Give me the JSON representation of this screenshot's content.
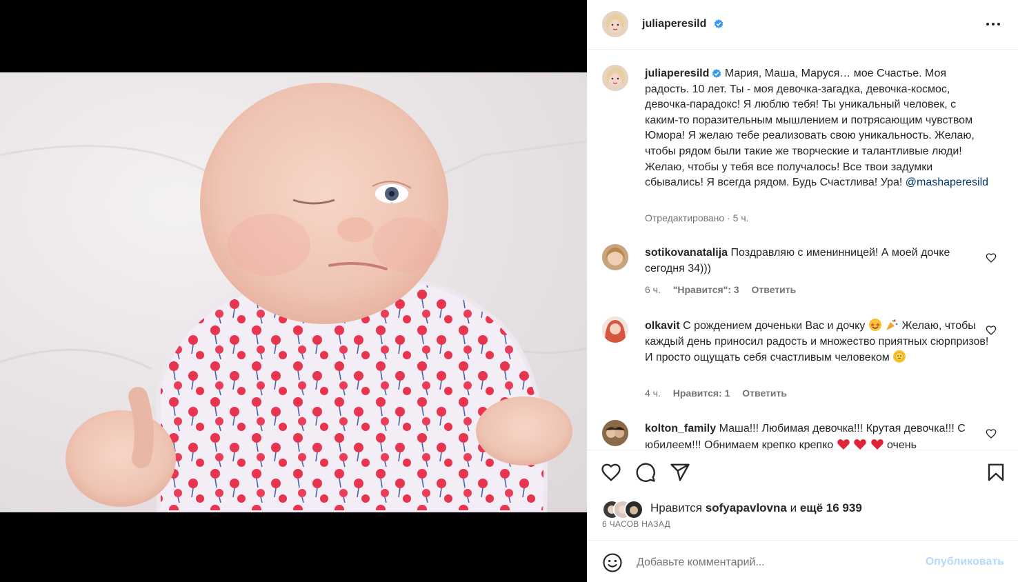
{
  "post": {
    "author": "juliaperesild",
    "caption": "Мария, Маша, Маруся… мое Счастье. Моя радость. 10 лет. Ты - моя девочка-загадка, девочка-космос, девочка-парадокс! Я люблю тебя! Ты уникальный человек, с каким-то поразительным мышлением и потрясающим чувством Юмора! Я желаю тебе реализовать свою уникальность. Желаю, чтобы рядом были такие же творческие и талантливые люди! Желаю, чтобы у тебя все получалось! Все твои задумки сбывались! Я всегда рядом. Будь Счастлива! Ура!",
    "mention": "@mashaperesild",
    "edited": "Отредактировано",
    "edited_sep": " · ",
    "edited_time": "5 ч."
  },
  "comments": [
    {
      "username": "sotikovanatalija",
      "text": "Поздравляю с именинницей! А моей дочке сегодня 34)))",
      "time": "6 ч.",
      "likes": "\"Нравится\": 3",
      "reply": "Ответить"
    },
    {
      "username": "olkavit",
      "text_before": "С рождением доченьки Вас и дочку",
      "text_after": "Желаю, чтобы каждый день приносил радость и множество приятных сюрпризов! И просто ощущать себя счастливым человеком",
      "time": "4 ч.",
      "likes": "Нравится: 1",
      "reply": "Ответить"
    },
    {
      "username": "kolton_family",
      "text_before": "Маша!!! Любимая девочка!!! Крутая девочка!!! С юбилеем!!! Обнимаем крепко крепко",
      "text_after": "очень"
    }
  ],
  "likes": {
    "prefix": "Нравится",
    "user": "sofyapavlovna",
    "connector": "и",
    "count": "ещё 16 939"
  },
  "time_ago": "6 ЧАСОВ НАЗАД",
  "comment_box": {
    "placeholder": "Добавьте комментарий...",
    "publish_label": "Опубликовать"
  },
  "icons": {
    "verified": "verified-badge-icon",
    "more": "more-options-icon",
    "like": "heart-icon",
    "comment": "comment-bubble-icon",
    "share": "paper-plane-icon",
    "save": "bookmark-icon",
    "emoji": "emoji-smiley-icon"
  },
  "colors": {
    "link": "#00376b",
    "verified": "#3897f0",
    "publish_disabled": "#b3dbff",
    "secondary_text": "#737373"
  }
}
